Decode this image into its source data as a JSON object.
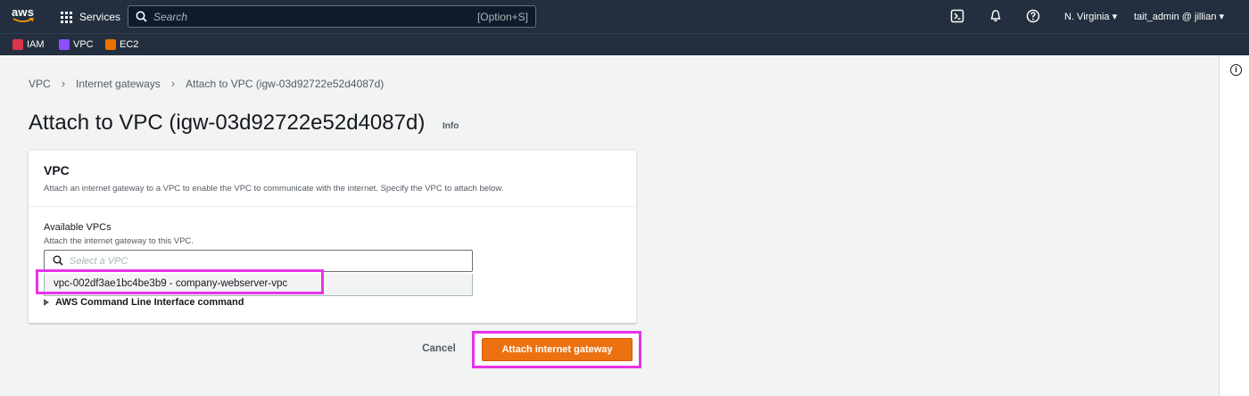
{
  "topnav": {
    "logo": "aws",
    "services_label": "Services",
    "search_placeholder": "Search",
    "search_shortcut": "[Option+S]",
    "region": "N. Virginia ▾",
    "account": "tait_admin @ jillian ▾"
  },
  "favorites": [
    {
      "label": "IAM",
      "color": "#dd344c"
    },
    {
      "label": "VPC",
      "color": "#8c4fff"
    },
    {
      "label": "EC2",
      "color": "#ed7100"
    }
  ],
  "breadcrumb": {
    "items": [
      "VPC",
      "Internet gateways"
    ],
    "current": "Attach to VPC (igw-03d92722e52d4087d)"
  },
  "page": {
    "title": "Attach to VPC (igw-03d92722e52d4087d)",
    "info": "Info"
  },
  "container": {
    "title": "VPC",
    "description": "Attach an internet gateway to a VPC to enable the VPC to communicate with the internet. Specify the VPC to attach below.",
    "field_label": "Available VPCs",
    "field_description": "Attach the internet gateway to this VPC.",
    "select_placeholder": "Select a VPC",
    "option": "vpc-002df3ae1bc4be3b9 - company-webserver-vpc",
    "cli_label": "AWS Command Line Interface command"
  },
  "actions": {
    "cancel": "Cancel",
    "primary": "Attach internet gateway"
  },
  "colors": {
    "nav_bg": "#232f3e",
    "primary": "#ec7211",
    "highlight": "#e832e8"
  }
}
